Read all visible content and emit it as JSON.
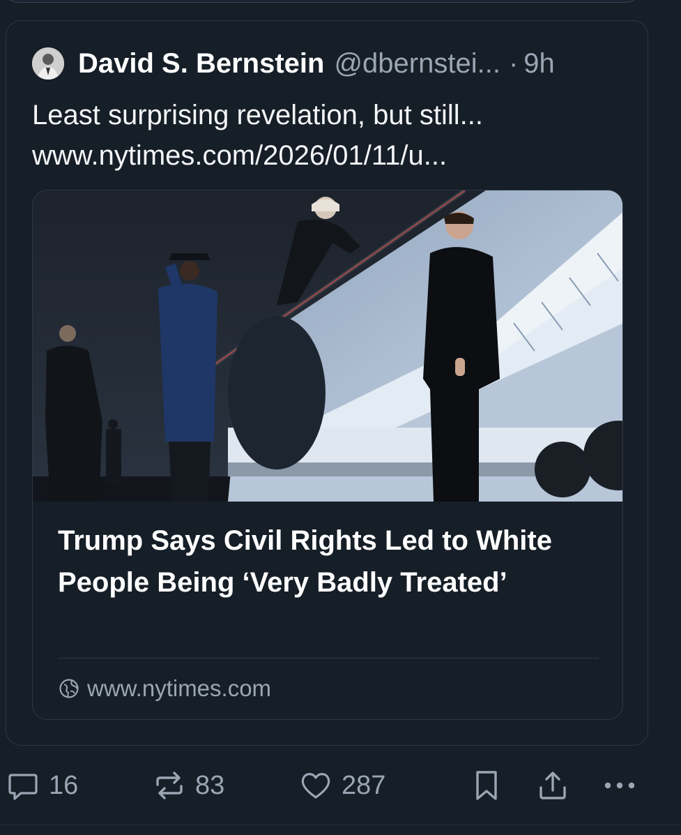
{
  "post": {
    "author_name": "David S. Bernstein",
    "author_handle": "@dbernstei...",
    "separator": "·",
    "time": "9h",
    "text_line1": "Least surprising revelation, but still...",
    "text_line2": "www.nytimes.com/2026/01/11/u...",
    "avatar_icon": "person-avatar"
  },
  "embed": {
    "title": "Trump Says Civil Rights Led to White People Being ‘Very Badly Treated’",
    "domain": "www.nytimes.com",
    "domain_icon": "globe-icon"
  },
  "actions": {
    "replies": "16",
    "reposts": "83",
    "likes": "287"
  },
  "colors": {
    "background": "#161e27",
    "border": "#2e3947",
    "muted_text": "#9aa6b3",
    "text": "#ffffff"
  }
}
